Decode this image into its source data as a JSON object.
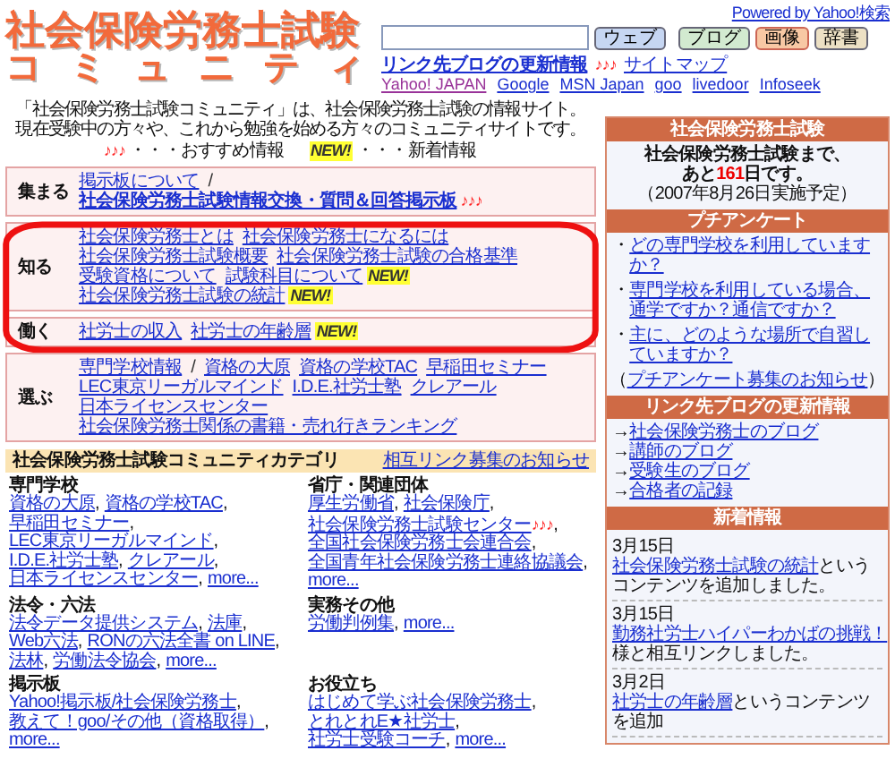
{
  "header": {
    "logo_line1": "社会保険労務士試験",
    "logo_line2": "コミュニティ",
    "powered_by": "Powered by Yahoo!検索",
    "search_buttons": [
      {
        "label": "ウェブ",
        "kind": "web"
      },
      {
        "label": "ブログ",
        "kind": "blog"
      },
      {
        "label": "画像",
        "kind": "image"
      },
      {
        "label": "辞書",
        "kind": "dict"
      }
    ],
    "blog_update_link": "リンク先ブログの更新情報",
    "blog_update_mark": "♪♪♪",
    "sitemap_link": "サイトマップ",
    "portal_links": [
      {
        "text": "Yahoo! JAPAN",
        "visited": true
      },
      {
        "text": "Google",
        "visited": false
      },
      {
        "text": "MSN Japan",
        "visited": false
      },
      {
        "text": "goo",
        "visited": false
      },
      {
        "text": "livedoor",
        "visited": false
      },
      {
        "text": "Infoseek",
        "visited": false
      }
    ]
  },
  "intro": {
    "lines": [
      "「社会保険労務士試験コミュニティ」は、社会保険労務士試験の情報サイト。",
      "現在受験中の方々や、これから勉強を始める方々のコミュニティサイトです。"
    ],
    "legend": [
      {
        "mark": "♪♪♪",
        "kind": "recommend",
        "text": "・・・おすすめ情報"
      },
      {
        "mark": "NEW!",
        "kind": "new",
        "text": "・・・新着情報"
      }
    ]
  },
  "nav_rows": [
    {
      "label": "集まる",
      "highlighted": false,
      "items": [
        {
          "kind": "link",
          "text": "掲示板について",
          "bold": false
        },
        {
          "kind": "slash",
          "text": "/"
        },
        {
          "kind": "link",
          "text": "社会保険労務士試験情報交換・質問＆回答掲示板",
          "bold": true,
          "badge": {
            "kind": "recommend",
            "text": "♪♪♪"
          }
        }
      ]
    },
    {
      "label": "知る",
      "highlighted": true,
      "items": [
        {
          "kind": "link",
          "text": "社会保険労務士とは",
          "bold": false
        },
        {
          "kind": "link",
          "text": "社会保険労務士になるには",
          "bold": false
        },
        {
          "kind": "link",
          "text": "社会保険労務士試験概要",
          "bold": false
        },
        {
          "kind": "link",
          "text": "社会保険労務士試験の合格基準",
          "bold": false
        },
        {
          "kind": "link",
          "text": "受験資格について",
          "bold": false
        },
        {
          "kind": "link",
          "text": "試験科目について",
          "bold": false,
          "badge": {
            "kind": "new",
            "text": "NEW!"
          }
        },
        {
          "kind": "link",
          "text": "社会保険労務士試験の統計",
          "bold": false,
          "badge": {
            "kind": "new",
            "text": "NEW!"
          }
        }
      ]
    },
    {
      "label": "働く",
      "highlighted": true,
      "items": [
        {
          "kind": "link",
          "text": "社労士の収入",
          "bold": false
        },
        {
          "kind": "link",
          "text": "社労士の年齢層",
          "bold": false,
          "badge": {
            "kind": "new",
            "text": "NEW!"
          }
        }
      ]
    },
    {
      "label": "選ぶ",
      "highlighted": false,
      "items": [
        {
          "kind": "link",
          "text": "専門学校情報",
          "bold": false
        },
        {
          "kind": "slash",
          "text": "/"
        },
        {
          "kind": "link",
          "text": "資格の大原",
          "bold": false
        },
        {
          "kind": "link",
          "text": "資格の学校TAC",
          "bold": false
        },
        {
          "kind": "link",
          "text": "早稲田セミナー",
          "bold": false
        },
        {
          "kind": "link",
          "text": "LEC東京リーガルマインド",
          "bold": false
        },
        {
          "kind": "link",
          "text": "I.D.E.社労士塾",
          "bold": false
        },
        {
          "kind": "link",
          "text": "クレアール",
          "bold": false
        },
        {
          "kind": "link",
          "text": "日本ライセンスセンター",
          "bold": false
        },
        {
          "kind": "link",
          "text": "社会保険労務士関係の書籍・売れ行きランキング",
          "bold": false
        }
      ]
    }
  ],
  "categories": {
    "title": "社会保険労務士試験コミュニティカテゴリ",
    "mutual_link": "相互リンク募集のお知らせ",
    "groups": [
      {
        "title": "専門学校",
        "links": [
          {
            "text": "資格の大原",
            "sep": ","
          },
          {
            "text": "資格の学校TAC",
            "sep": ","
          },
          {
            "text": "早稲田セミナー",
            "sep": ","
          },
          {
            "text": "LEC東京リーガルマインド",
            "sep": ","
          },
          {
            "text": "I.D.E.社労士塾",
            "sep": ","
          },
          {
            "text": "クレアール",
            "sep": ","
          },
          {
            "text": "日本ライセンスセンター",
            "sep": ","
          }
        ],
        "more": "more..."
      },
      {
        "title": "省庁・関連団体",
        "links": [
          {
            "text": "厚生労働省",
            "sep": ","
          },
          {
            "text": "社会保険庁",
            "sep": ","
          },
          {
            "text": "社会保険労務士試験センター",
            "sep": ",",
            "badge": {
              "kind": "recommend",
              "text": "♪♪♪"
            }
          },
          {
            "text": "全国社会保険労務士会連合会",
            "sep": ","
          },
          {
            "text": "全国青年社会保険労務士連絡協議会",
            "sep": ","
          }
        ],
        "more": "more..."
      },
      {
        "title": "法令・六法",
        "links": [
          {
            "text": "法令データ提供システム",
            "sep": ","
          },
          {
            "text": "法庫",
            "sep": ","
          },
          {
            "text": "Web六法",
            "sep": ","
          },
          {
            "text": "RONの六法全書 on LINE",
            "sep": ","
          },
          {
            "text": "法林",
            "sep": ","
          },
          {
            "text": "労働法令協会",
            "sep": ","
          }
        ],
        "more": "more..."
      },
      {
        "title": "実務その他",
        "links": [
          {
            "text": "労働判例集",
            "sep": ","
          }
        ],
        "more": "more..."
      },
      {
        "title": "掲示板",
        "links": [
          {
            "text": "Yahoo!掲示板/社会保険労務士",
            "sep": ","
          },
          {
            "text": "教えて！goo/その他（資格取得）",
            "sep": ","
          }
        ],
        "more": "more..."
      },
      {
        "title": "お役立ち",
        "links": [
          {
            "text": "はじめて学ぶ社会保険労務士",
            "sep": ","
          },
          {
            "text": "とれとれE★社労士",
            "sep": ","
          },
          {
            "text": "社労士受験コーチ",
            "sep": ","
          }
        ],
        "more": "more..."
      }
    ]
  },
  "sidebar": {
    "countdown": {
      "title": "社会保険労務士試験",
      "line1": "社会保険労務士試験まで、",
      "before": "あと",
      "days": "161",
      "after": "日です。",
      "note": "（2007年8月26日実施予定）"
    },
    "survey": {
      "title": "プチアンケート",
      "items": [
        {
          "bullet": "・",
          "text": "どの専門学校を利用していますか？"
        },
        {
          "bullet": "・",
          "text": "専門学校を利用している場合、通学ですか？通信ですか？"
        },
        {
          "bullet": "・",
          "text": "主に、どのような場所で自習していますか？"
        }
      ],
      "open": "（",
      "notice_link": "プチアンケート募集のお知らせ",
      "close": "）"
    },
    "blogs": {
      "title": "リンク先ブログの更新情報",
      "items": [
        {
          "arrow": "→",
          "text": "社会保険労務士のブログ"
        },
        {
          "arrow": "→",
          "text": "講師のブログ"
        },
        {
          "arrow": "→",
          "text": "受験生のブログ"
        },
        {
          "arrow": "→",
          "text": "合格者の記録"
        }
      ]
    },
    "news": {
      "title": "新着情報",
      "items": [
        {
          "date": "3月15日",
          "link": "社会保険労務士試験の統計",
          "rest": "というコンテンツを追加しました。"
        },
        {
          "date": "3月15日",
          "link": "勤務社労士ハイパーわかばの挑戦！",
          "rest": "様と相互リンクしました。"
        },
        {
          "date": "3月2日",
          "link": "社労士の年齢層",
          "rest": "というコンテンツを追加"
        }
      ]
    }
  }
}
